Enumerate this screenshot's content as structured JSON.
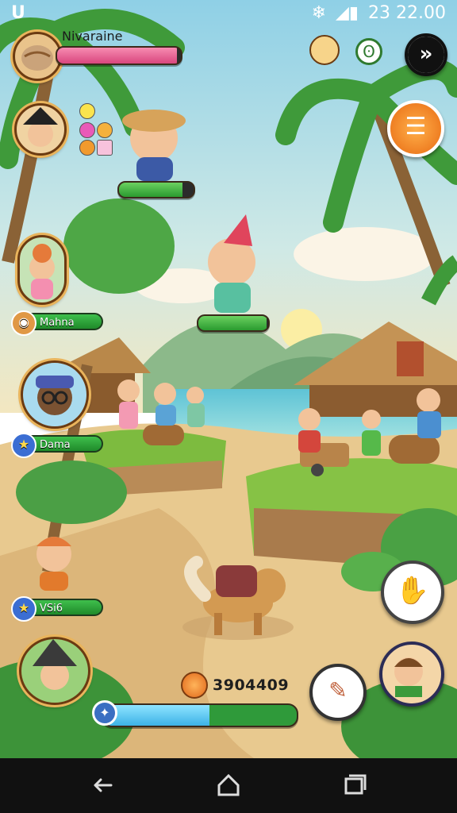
{
  "status_bar": {
    "app_glyph": "U",
    "time": "23 22.00",
    "icons": [
      "snowflake-icon",
      "signal-icon"
    ]
  },
  "player": {
    "name": "Nivaraine",
    "health_fraction": 0.97,
    "colors": {
      "health": "#e8588e"
    }
  },
  "villagers": [
    {
      "id": "villager-top",
      "name": "",
      "energy_fraction": 0.85
    },
    {
      "id": "villager-red-hat",
      "name": "",
      "energy_fraction": 0.98
    },
    {
      "id": "portrait-mahna",
      "name": "Mahna"
    },
    {
      "id": "portrait-dama",
      "name": "Dama"
    },
    {
      "id": "portrait-vsie",
      "name": "VSi6"
    }
  ],
  "resources": {
    "coins_value": "3904409",
    "progress_fraction": 0.55,
    "colors": {
      "blue": "#56c7ef",
      "green": "#3cb54a"
    }
  },
  "buttons": {
    "skip": "skip-arrow-icon",
    "menu": "menu-icon",
    "grab": "hand-grab-icon",
    "character": "character-icon",
    "tool": "tool-icon"
  },
  "nav": {
    "back": "back-icon",
    "home": "home-icon",
    "recent": "recent-apps-icon"
  }
}
